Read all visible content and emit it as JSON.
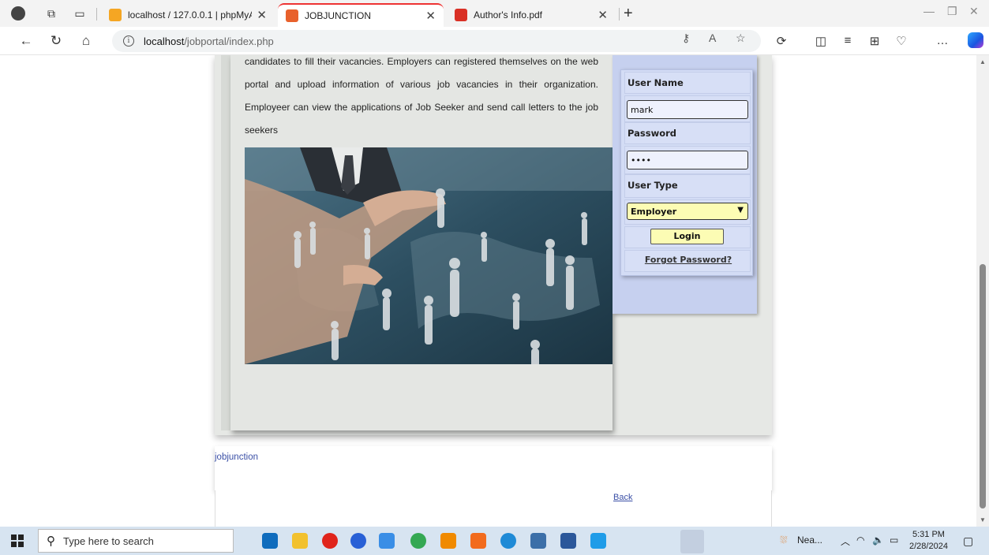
{
  "browser": {
    "tabs": [
      {
        "title": "localhost / 127.0.0.1 | phpMyAdm",
        "favicon_color": "#f5a623"
      },
      {
        "title": "JOBJUNCTION",
        "favicon_color": "#e8612c",
        "active": true
      },
      {
        "title": "Author's Info.pdf",
        "favicon_color": "#d93025"
      }
    ],
    "address": {
      "host": "localhost",
      "path": "/jobportal/index.php"
    }
  },
  "page": {
    "intro": "candidates to fill their vacancies. Employers can registered themselves on the web portal and upload information of various job vacancies in their organization. Employeer can view the applications of Job Seeker and send call letters to the job seekers",
    "login": {
      "username_label": "User Name",
      "username_value": "mark",
      "password_label": "Password",
      "password_value": "••••",
      "usertype_label": "User Type",
      "usertype_selected": "Employer",
      "login_button": "Login",
      "forgot_link": "Forgot Password?"
    },
    "footer_link": "jobjunction",
    "back_link": "Back"
  },
  "taskbar": {
    "search_placeholder": "Type here to search",
    "weather": "Nea...",
    "time": "5:31 PM",
    "date": "2/28/2024"
  },
  "colors": {
    "panel_bg": "#e4e6e3",
    "login_bg": "#c6d0ef",
    "field_yellow": "#fcfcb4",
    "link_blue": "#3a4fa6"
  }
}
